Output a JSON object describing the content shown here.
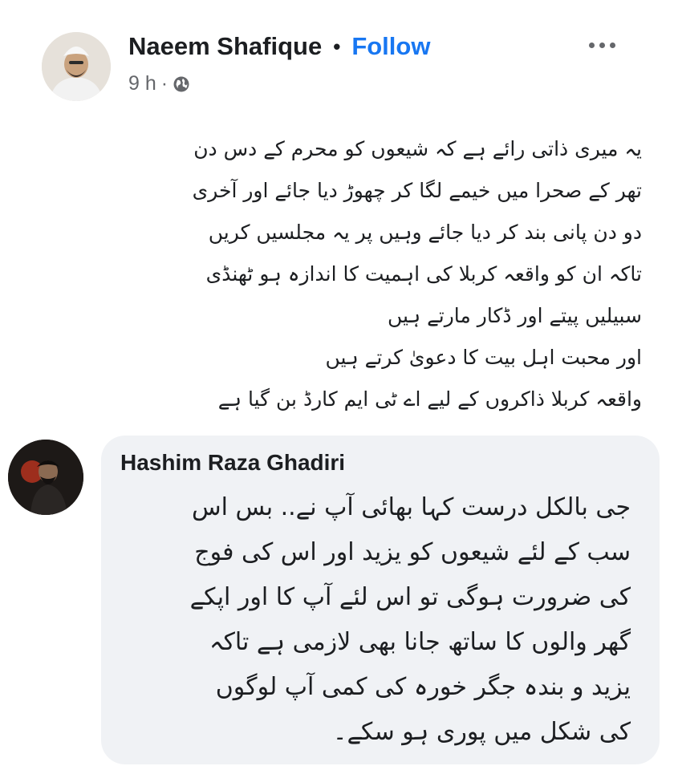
{
  "post": {
    "author": "Naeem Shafique",
    "separator": "•",
    "follow_label": "Follow",
    "more_icon": "more-horizontal-icon",
    "time": "9 h",
    "meta_separator": "·",
    "privacy_icon": "globe-icon",
    "body_lines": [
      "یہ میری ذاتی رائے ہے کہ شیعوں کو محرم کے دس دن",
      "تھر کے صحرا میں خیمے لگا کر چھوڑ دیا جائے اور آخری",
      "دو دن پانی بند کر دیا جائے وہیں پر یہ مجلسیں کریں",
      "تاکہ ان کو واقعہ کربلا کی اہمیت کا اندازہ ہو ٹھنڈی",
      "سبیلیں پیتے اور ڈکار مارتے ہیں",
      "اور محبت اہل بیت کا دعویٰ کرتے ہیں",
      "واقعہ کربلا ذاکروں کے لیے اے ٹی ایم کارڈ بن گیا ہے"
    ]
  },
  "comment": {
    "author": "Hashim Raza Ghadiri",
    "text_lines": [
      "جی بالکل درست کہا بھائی آپ نے.. بس اس",
      "سب کے لئے شیعوں کو یزید اور اس کی فوج",
      "کی ضرورت ہوگی تو اس لئے آپ کا اور اپکے",
      "گھر والوں کا ساتھ جانا بھی لازمی ہے تاکہ",
      "یزید و بندہ جگر خورہ کی کمی آپ لوگوں",
      "کی شکل میں پوری ہو سکے۔"
    ]
  },
  "colors": {
    "link": "#1877f2",
    "secondary_text": "#65676b",
    "comment_bubble": "#f0f2f5"
  }
}
